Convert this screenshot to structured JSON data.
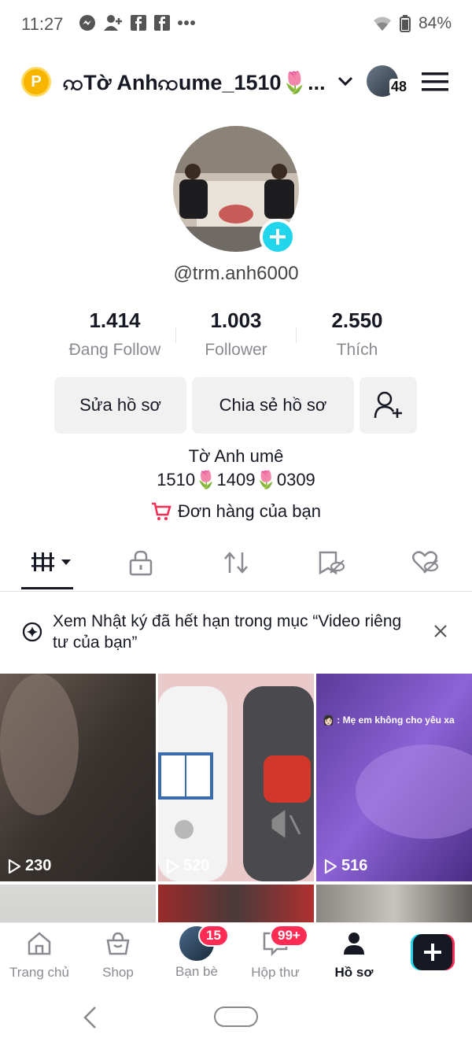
{
  "status_bar": {
    "time": "11:27",
    "battery": "84%",
    "icons": [
      "messenger-icon",
      "person-add-icon",
      "facebook-icon",
      "facebook-icon",
      "more-dots-icon",
      "wifi-icon",
      "battery-icon"
    ]
  },
  "header": {
    "coin_letter": "P",
    "username": "ꩡTờ Anhꩡume_1510🌷...",
    "notification_count": "48"
  },
  "profile": {
    "handle": "@trm.anh6000",
    "stats": [
      {
        "value": "1.414",
        "label": "Đang Follow"
      },
      {
        "value": "1.003",
        "label": "Follower"
      },
      {
        "value": "2.550",
        "label": "Thích"
      }
    ],
    "edit_label": "Sửa hồ sơ",
    "share_label": "Chia sẻ hồ sơ",
    "bio_line1": "Tờ Anh umê",
    "bio_line2": "1510🌷1409🌷0309",
    "orders_label": "Đơn hàng của bạn"
  },
  "tabs": [
    "videos-grid",
    "private",
    "reposts",
    "favorites",
    "liked-hidden"
  ],
  "notice": {
    "text": "Xem Nhật ký đã hết hạn trong mục “Video riêng tư của bạn”"
  },
  "videos": [
    {
      "views": "230"
    },
    {
      "views": "520"
    },
    {
      "views": "516",
      "caption": "👩🏻 : Mẹ em không cho yêu xa"
    }
  ],
  "bottom_nav": [
    {
      "label": "Trang chủ"
    },
    {
      "label": "Shop"
    },
    {
      "label": "Bạn bè",
      "badge": "15"
    },
    {
      "label": "Hộp thư",
      "badge": "99+"
    },
    {
      "label": "Hồ sơ"
    }
  ],
  "colors": {
    "accent": "#fe2c55",
    "cyan": "#20d5ec",
    "text": "#161823",
    "muted": "#8a8b91"
  }
}
